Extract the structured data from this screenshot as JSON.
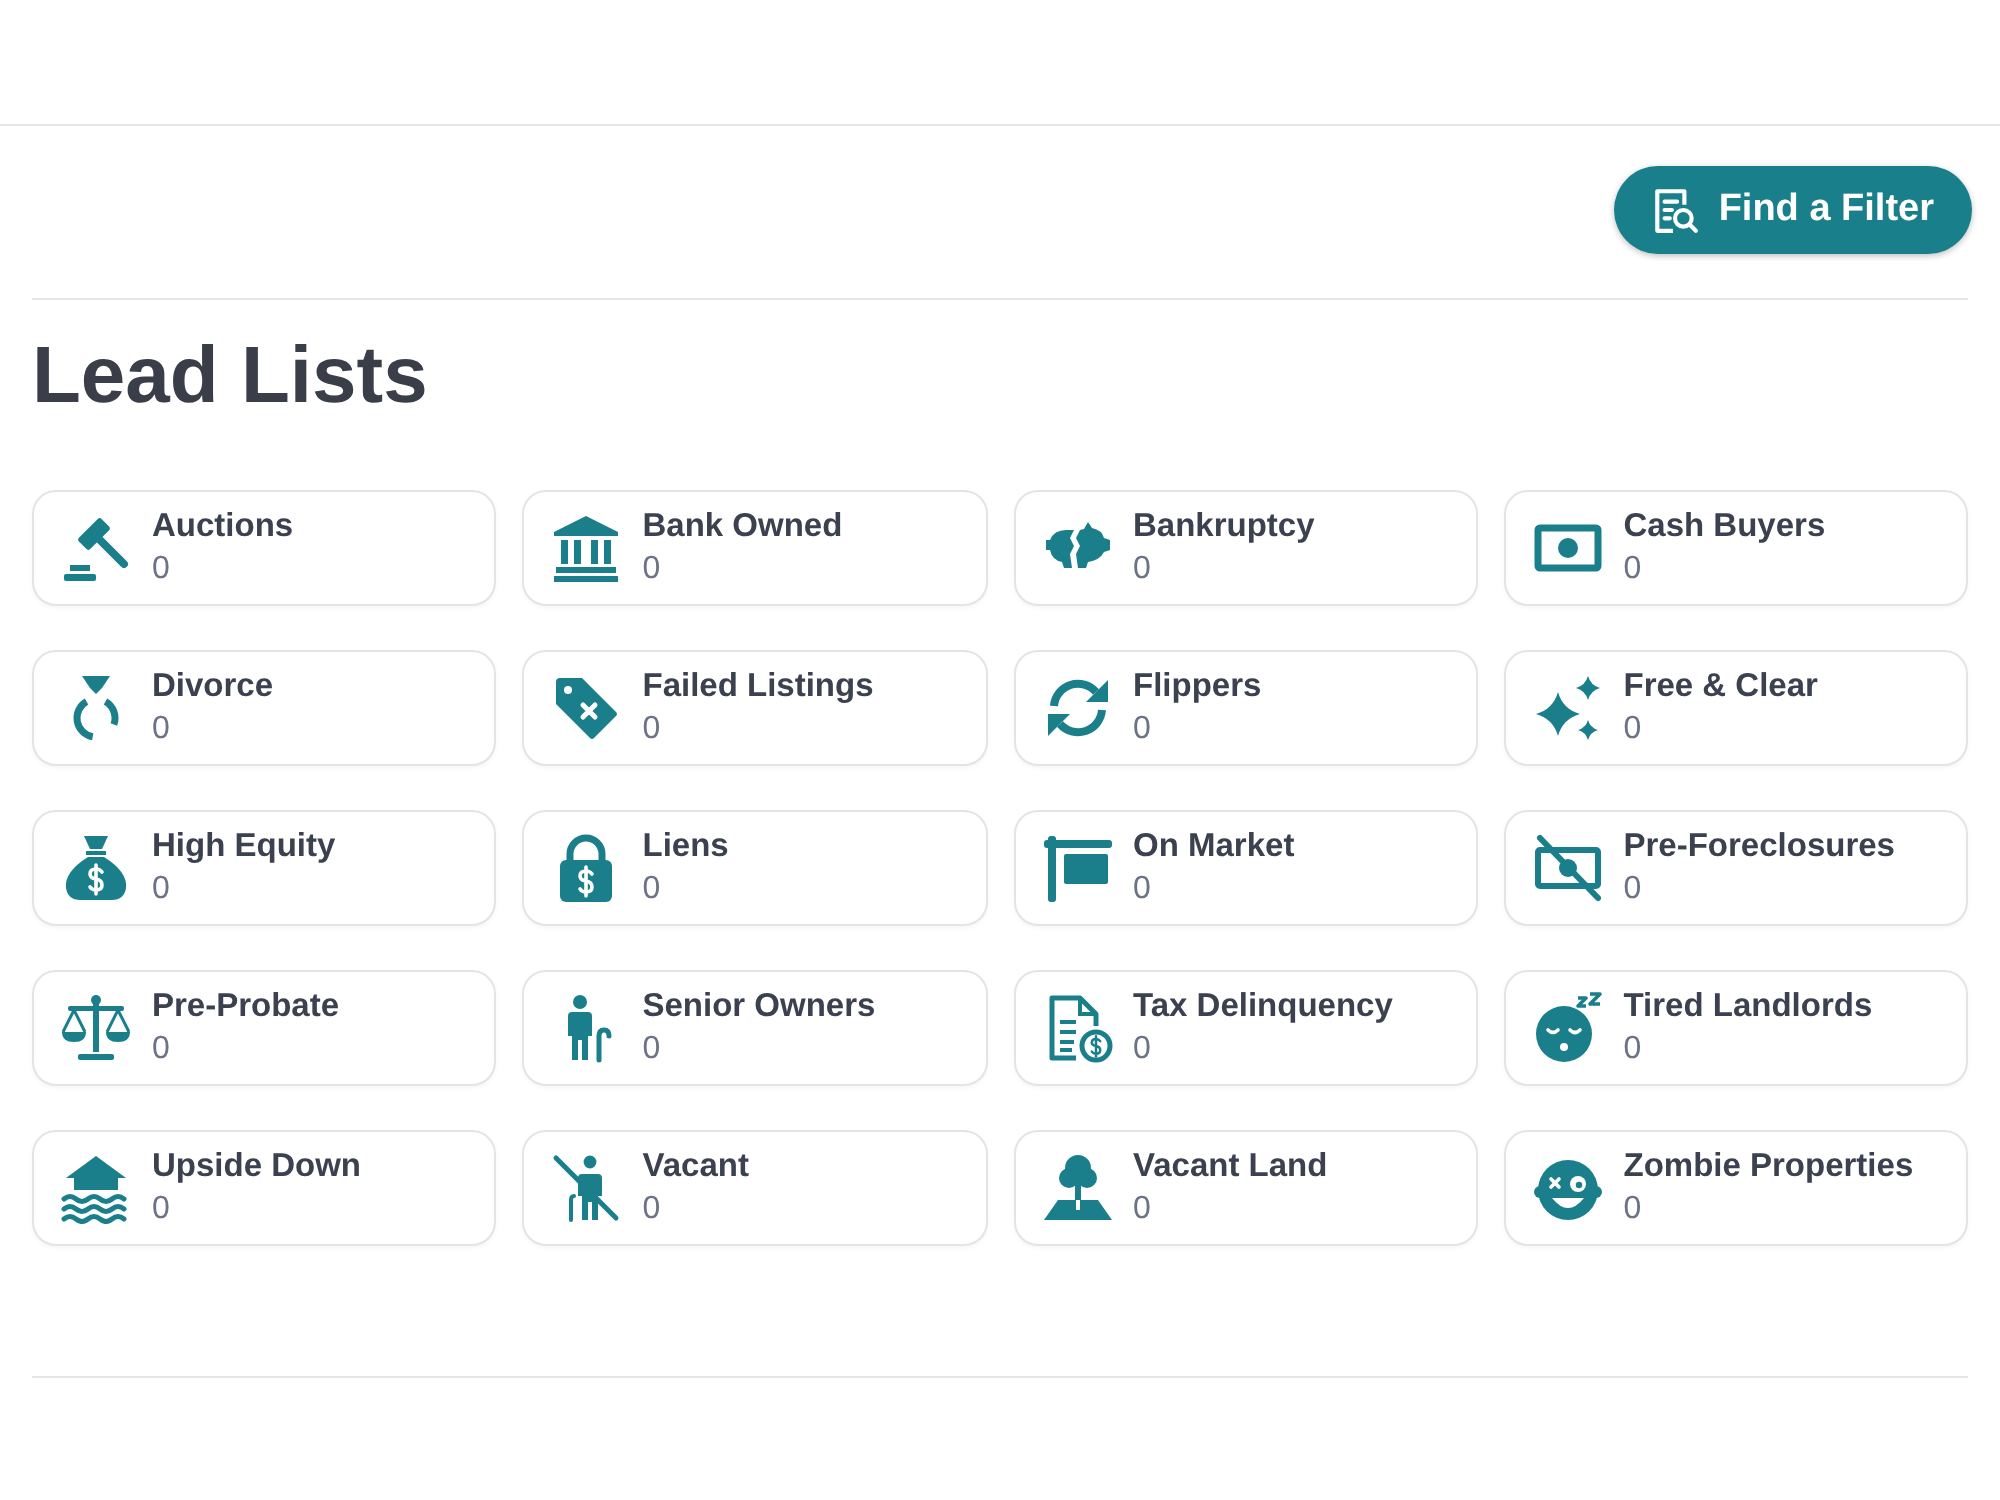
{
  "toolbar": {
    "find_filter_button": {
      "label": "Find a Filter"
    }
  },
  "page": {
    "title": "Lead Lists"
  },
  "lead_lists": [
    {
      "name": "Auctions",
      "count": "0"
    },
    {
      "name": "Bank Owned",
      "count": "0"
    },
    {
      "name": "Bankruptcy",
      "count": "0"
    },
    {
      "name": "Cash Buyers",
      "count": "0"
    },
    {
      "name": "Divorce",
      "count": "0"
    },
    {
      "name": "Failed Listings",
      "count": "0"
    },
    {
      "name": "Flippers",
      "count": "0"
    },
    {
      "name": "Free & Clear",
      "count": "0"
    },
    {
      "name": "High Equity",
      "count": "0"
    },
    {
      "name": "Liens",
      "count": "0"
    },
    {
      "name": "On Market",
      "count": "0"
    },
    {
      "name": "Pre-Foreclosures",
      "count": "0"
    },
    {
      "name": "Pre-Probate",
      "count": "0"
    },
    {
      "name": "Senior Owners",
      "count": "0"
    },
    {
      "name": "Tax Delinquency",
      "count": "0"
    },
    {
      "name": "Tired Landlords",
      "count": "0"
    },
    {
      "name": "Upside Down",
      "count": "0"
    },
    {
      "name": "Vacant",
      "count": "0"
    },
    {
      "name": "Vacant Land",
      "count": "0"
    },
    {
      "name": "Zombie Properties",
      "count": "0"
    }
  ]
}
